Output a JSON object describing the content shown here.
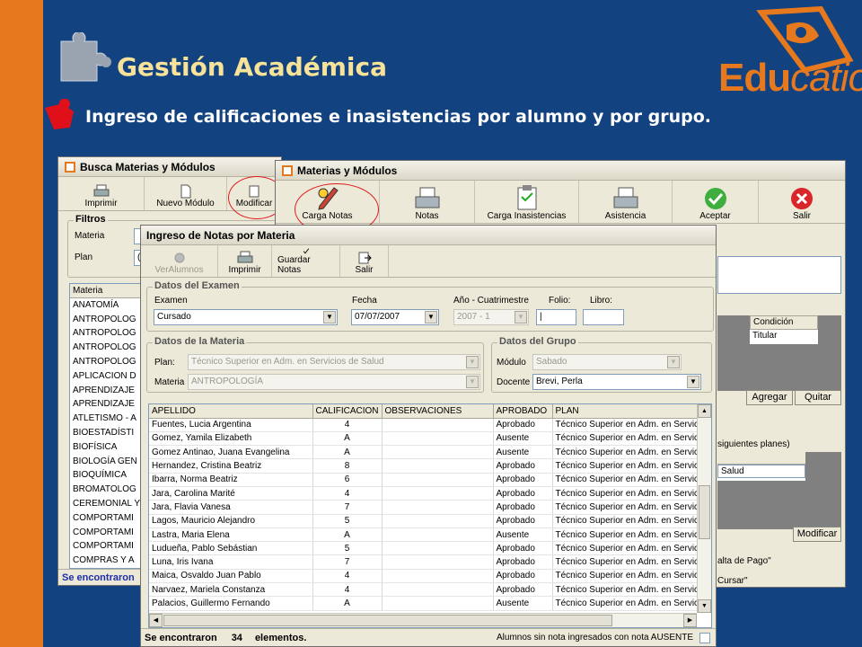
{
  "slide": {
    "title": "Gestión Académica",
    "subtitle": "Ingreso de calificaciones e inasistencias por alumno y por grupo.",
    "logo_brand": "Edu",
    "logo_rest": "catio",
    "logo_reg": "®"
  },
  "busca": {
    "title": "Busca Materias y Módulos",
    "toolbar": [
      "Imprimir",
      "Nuevo Módulo",
      "Modificar"
    ],
    "filters_title": "Filtros",
    "materia_label": "Materia",
    "plan_label": "Plan",
    "plan_value": "(",
    "list_header": "Materia",
    "list_items": [
      "ANATOMÍA",
      "ANTROPOLOG",
      "ANTROPOLOG",
      "ANTROPOLOG",
      "ANTROPOLOG",
      "APLICACION D",
      "APRENDIZAJE",
      "APRENDIZAJE",
      "ATLETISMO - A",
      "BIOESTADÍSTI",
      "BIOFÍSICA",
      "BIOLOGÍA GEN",
      "BIOQUÍMICA",
      "BROMATOLOG",
      "CEREMONIAL Y",
      "COMPORTAMI",
      "COMPORTAMI",
      "COMPORTAMI",
      "COMPRAS Y A"
    ],
    "status": "Se encontraron"
  },
  "materias": {
    "title": "Materias y Módulos",
    "toolbar": [
      "Carga Notas",
      "Notas",
      "Carga Inasistencias",
      "Asistencia",
      "Aceptar",
      "Salir"
    ],
    "cond_headers": [
      "Condición"
    ],
    "cond_rows": [
      "Titular"
    ],
    "btn_agregar": "Agregar",
    "btn_quitar": "Quitar",
    "planes_label": "siguientes planes)",
    "planes_row": "Salud",
    "btn_modificar": "Modificar",
    "falta_pago": "alta de Pago\"",
    "cursar": "Cursar\""
  },
  "notas": {
    "title": "Ingreso de Notas por Materia",
    "toolbar": {
      "ver": "VerAlumnos",
      "imprimir": "Imprimir",
      "guardar": "Guardar Notas",
      "salir": "Salir"
    },
    "examen_group": "Datos del Examen",
    "examen_label": "Examen",
    "examen_value": "Cursado",
    "fecha_label": "Fecha",
    "fecha_value": "07/07/2007",
    "anio_label": "Año - Cuatrimestre",
    "anio_value": "2007 - 1",
    "folio_label": "Folio:",
    "folio_value": "|",
    "libro_label": "Libro:",
    "libro_value": "",
    "materia_group": "Datos de la Materia",
    "plan_label": "Plan:",
    "plan_value": "Técnico Superior en Adm. en Servicios de Salud",
    "materia_label": "Materia",
    "materia_value": "ANTROPOLOGÍA",
    "grupo_group": "Datos del Grupo",
    "modulo_label": "Módulo",
    "modulo_value": "Sabado",
    "docente_label": "Docente",
    "docente_value": "Brevi, Perla",
    "columns": [
      "APELLIDO",
      "CALIFICACION",
      "OBSERVACIONES",
      "APROBADO",
      "PLAN"
    ],
    "rows": [
      [
        "Fuentes, Lucia Argentina",
        "4",
        "",
        "Aprobado",
        "Técnico Superior en Adm. en Servic"
      ],
      [
        "Gomez, Yamila Elizabeth",
        "A",
        "",
        "Ausente",
        "Técnico Superior en Adm. en Servic"
      ],
      [
        "Gomez Antinao, Juana Evangelina",
        "A",
        "",
        "Ausente",
        "Técnico Superior en Adm. en Servic"
      ],
      [
        "Hernandez, Cristina Beatriz",
        "8",
        "",
        "Aprobado",
        "Técnico Superior en Adm. en Servic"
      ],
      [
        "Ibarra, Norma Beatriz",
        "6",
        "",
        "Aprobado",
        "Técnico Superior en Adm. en Servic"
      ],
      [
        "Jara, Carolina Marité",
        "4",
        "",
        "Aprobado",
        "Técnico Superior en Adm. en Servic"
      ],
      [
        "Jara, Flavia Vanesa",
        "7",
        "",
        "Aprobado",
        "Técnico Superior en Adm. en Servic"
      ],
      [
        "Lagos, Mauricio Alejandro",
        "5",
        "",
        "Aprobado",
        "Técnico Superior en Adm. en Servic"
      ],
      [
        "Lastra, Maria Elena",
        "A",
        "",
        "Ausente",
        "Técnico Superior en Adm. en Servic"
      ],
      [
        "Ludueña, Pablo Sebástian",
        "5",
        "",
        "Aprobado",
        "Técnico Superior en Adm. en Servic"
      ],
      [
        "Luna, Iris Ivana",
        "7",
        "",
        "Aprobado",
        "Técnico Superior en Adm. en Servic"
      ],
      [
        "Maica, Osvaldo Juan Pablo",
        "4",
        "",
        "Aprobado",
        "Técnico Superior en Adm. en Servic"
      ],
      [
        "Narvaez, Mariela Constanza",
        "4",
        "",
        "Aprobado",
        "Técnico Superior en Adm. en Servic"
      ],
      [
        "Palacios, Guillermo Fernando",
        "A",
        "",
        "Ausente",
        "Técnico Superior en Adm. en Servic"
      ]
    ],
    "status_prefix": "Se encontraron",
    "status_count": "34",
    "status_suffix": "elementos.",
    "ausente_label": "Alumnos sin nota ingresados con nota AUSENTE"
  },
  "colors": {
    "background": "#12427f",
    "accent": "#e6781e",
    "title": "#f7e29a"
  }
}
